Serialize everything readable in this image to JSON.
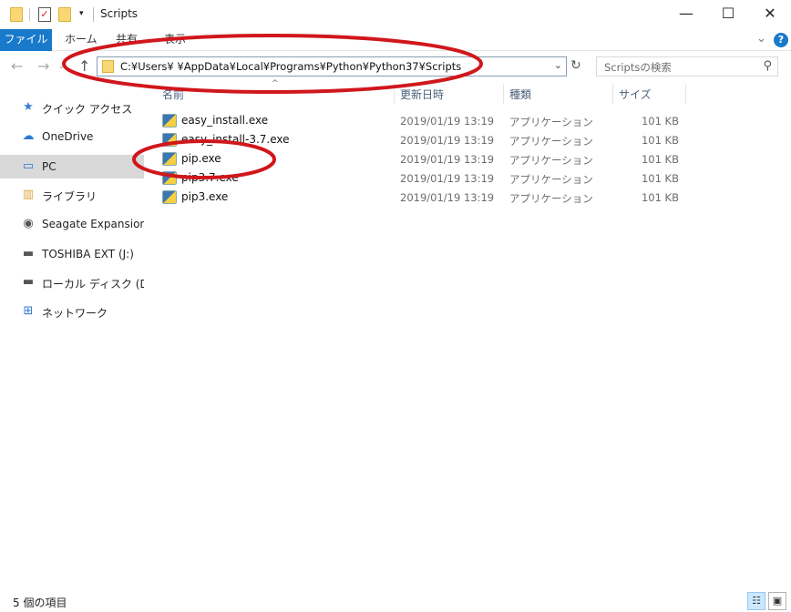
{
  "window": {
    "title": "Scripts",
    "minimize_glyph": "—",
    "maximize_glyph": "☐",
    "close_glyph": "✕"
  },
  "quick_access_toolbar": {
    "dropdown_glyph": "▾"
  },
  "ribbon": {
    "tabs": [
      "ファイル",
      "ホーム",
      "共有",
      "表示"
    ],
    "expand_glyph": "⌄",
    "help_glyph": "?"
  },
  "navigation": {
    "back_glyph": "←",
    "forward_glyph": "→",
    "recent_glyph": "⌄",
    "up_glyph": "↑",
    "address_path": "C:¥Users¥      ¥AppData¥Local¥Programs¥Python¥Python37¥Scripts",
    "address_dropdown_glyph": "⌄",
    "refresh_glyph": "↻",
    "search_placeholder": "Scriptsの検索",
    "search_glyph": "⚲"
  },
  "sidebar": {
    "items": [
      {
        "label": "クイック アクセス",
        "icon": "star-icon",
        "glyph": "★",
        "color": "#3a7bd5"
      },
      {
        "label": "OneDrive",
        "icon": "cloud-icon",
        "glyph": "☁",
        "color": "#2f78d0"
      },
      {
        "label": "PC",
        "icon": "monitor-icon",
        "glyph": "▭",
        "color": "#2f78d0",
        "selected": true
      },
      {
        "label": "ライブラリ",
        "icon": "library-icon",
        "glyph": "▥",
        "color": "#d9a53a"
      },
      {
        "label": "Seagate Expansion Dr",
        "icon": "drive-icon",
        "glyph": "◉",
        "color": "#555555"
      },
      {
        "label": "TOSHIBA EXT (J:)",
        "icon": "usb-drive-icon",
        "glyph": "▬",
        "color": "#555555"
      },
      {
        "label": "ローカル ディスク (D:)",
        "icon": "disk-icon",
        "glyph": "▬",
        "color": "#555555"
      },
      {
        "label": "ネットワーク",
        "icon": "network-icon",
        "glyph": "⊞",
        "color": "#2f78d0"
      }
    ]
  },
  "columns": {
    "name": "名前",
    "modified": "更新日時",
    "type": "種類",
    "size": "サイズ",
    "sort_glyph": "^"
  },
  "files": [
    {
      "name": "easy_install.exe",
      "modified": "2019/01/19 13:19",
      "type": "アプリケーション",
      "size": "101 KB"
    },
    {
      "name": "easy_install-3.7.exe",
      "modified": "2019/01/19 13:19",
      "type": "アプリケーション",
      "size": "101 KB"
    },
    {
      "name": "pip.exe",
      "modified": "2019/01/19 13:19",
      "type": "アプリケーション",
      "size": "101 KB"
    },
    {
      "name": "pip3.7.exe",
      "modified": "2019/01/19 13:19",
      "type": "アプリケーション",
      "size": "101 KB"
    },
    {
      "name": "pip3.exe",
      "modified": "2019/01/19 13:19",
      "type": "アプリケーション",
      "size": "101 KB"
    }
  ],
  "status": {
    "item_count": "5 個の項目",
    "details_view_glyph": "☷",
    "large_icons_glyph": "▣"
  },
  "colors": {
    "accent": "#1979ca",
    "annotation": "#d0171c"
  }
}
